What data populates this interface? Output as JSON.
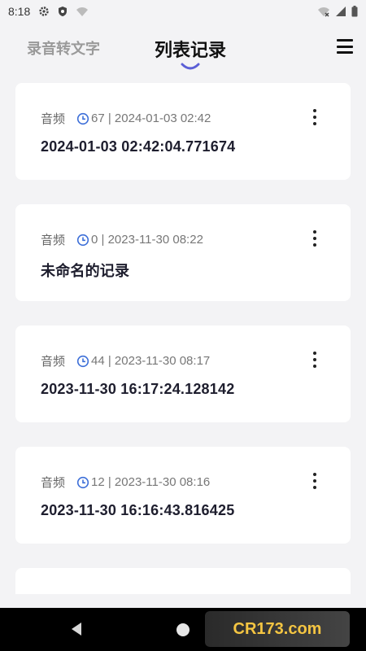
{
  "status_bar": {
    "time": "8:18"
  },
  "header": {
    "tab_inactive": "录音转文字",
    "tab_active": "列表记录"
  },
  "records": [
    {
      "type": "音频",
      "info": "67 | 2024-01-03 02:42",
      "title": "2024-01-03 02:42:04.771674"
    },
    {
      "type": "音频",
      "info": "0 | 2023-11-30 08:22",
      "title": "未命名的记录"
    },
    {
      "type": "音频",
      "info": "44 | 2023-11-30 08:17",
      "title": "2023-11-30 16:17:24.128142"
    },
    {
      "type": "音频",
      "info": "12 | 2023-11-30 08:16",
      "title": "2023-11-30 16:16:43.816425"
    }
  ],
  "watermark": {
    "text": "CR173.com"
  },
  "colors": {
    "accent": "#5b5fd6",
    "clock": "#3d6fd8",
    "card_bg": "#ffffff",
    "page_bg": "#f3f3f5"
  }
}
